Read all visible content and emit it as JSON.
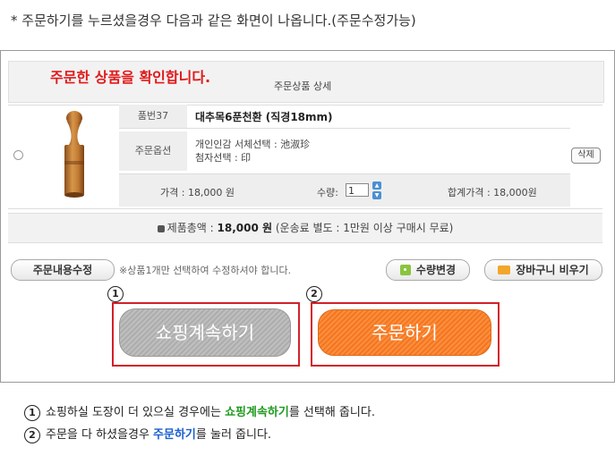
{
  "top_note": "* 주문하기를 누르셨을경우 다음과 같은 화면이 나옵니다.(주문수정가능)",
  "header": {
    "confirm_text": "주문한 상품을 확인합니다.",
    "title": "주문상품 상세"
  },
  "item": {
    "code_label": "품번37",
    "product_name": "대추목6푼천환 (직경18mm)",
    "option_label": "주문옵션",
    "option_line1": "개인인감 서체선택 : 池淑珍",
    "option_line2": "첨자선택 : 印",
    "price_text": "가격 : 18,000 원",
    "qty_label": "수량:",
    "qty_value": "1",
    "total_price_text": "합계가격 : 18,000원",
    "delete_label": "삭제"
  },
  "total": {
    "prefix": "제품총액 : ",
    "amount": "18,000 원",
    "note": " (운송료 별도 : 1만원 이상 구매시 무료)"
  },
  "actions": {
    "edit_label": "주문내용수정",
    "edit_note": "※상품1개만 선택하여 수정하셔야 합니다.",
    "qty_change_label": "수량변경",
    "empty_cart_label": "장바구니 비우기"
  },
  "markers": {
    "one": "1",
    "two": "2"
  },
  "buttons": {
    "shop_label": "쇼핑계속하기",
    "order_label": "주문하기"
  },
  "footnotes": {
    "line1_pre": "쇼핑하실 도장이 더 있으실 경우에는 ",
    "line1_hl": "쇼핑계속하기",
    "line1_post": "를 선택해 줍니다.",
    "line2_pre": "주문을 다 하셨을경우 ",
    "line2_hl": "주문하기",
    "line2_post": "를 눌러 줍니다."
  },
  "colors": {
    "highlight_red": "#e0191a",
    "order_orange": "#f47620",
    "box_red": "#d2202a",
    "green": "#1f9a1f",
    "blue": "#1a5fd0"
  }
}
